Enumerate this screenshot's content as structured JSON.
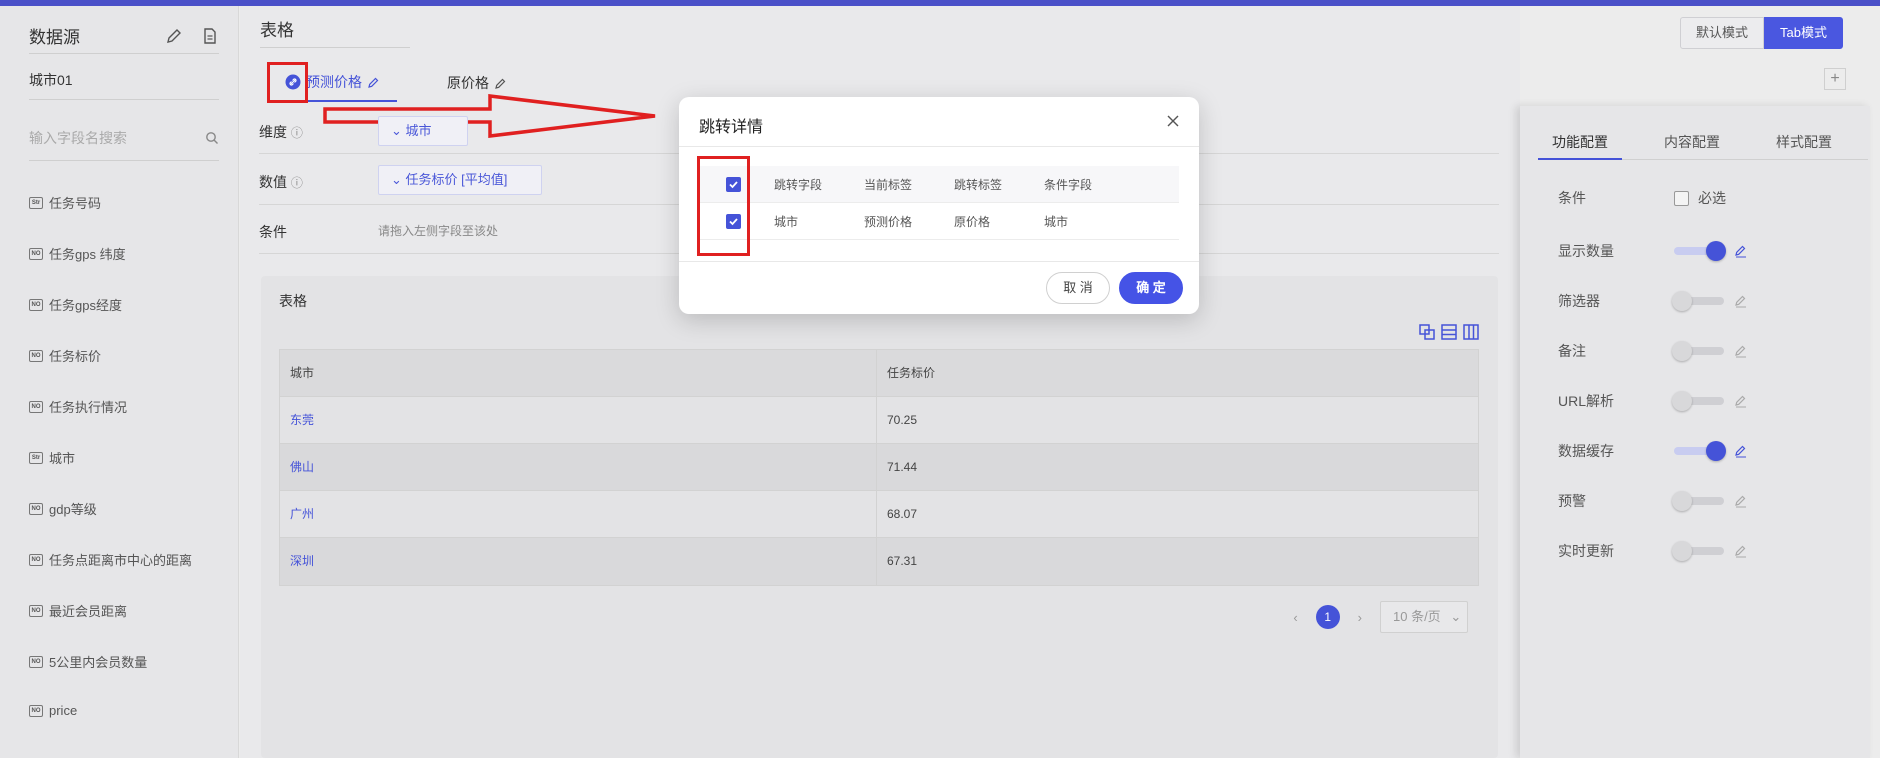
{
  "left": {
    "title": "数据源",
    "city": "城市01",
    "search_placeholder": "输入字段名搜索",
    "fields": [
      {
        "type": "Str",
        "name": "任务号码"
      },
      {
        "type": "NO",
        "name": "任务gps 纬度"
      },
      {
        "type": "NO",
        "name": "任务gps经度"
      },
      {
        "type": "NO",
        "name": "任务标价"
      },
      {
        "type": "NO",
        "name": "任务执行情况"
      },
      {
        "type": "Str",
        "name": "城市"
      },
      {
        "type": "NO",
        "name": "gdp等级"
      },
      {
        "type": "NO",
        "name": "任务点距离市中心的距离"
      },
      {
        "type": "NO",
        "name": "最近会员距离"
      },
      {
        "type": "NO",
        "name": "5公里内会员数量"
      },
      {
        "type": "NO",
        "name": "price"
      }
    ]
  },
  "main": {
    "title": "表格",
    "tabs": [
      {
        "label": "预测价格"
      },
      {
        "label": "原价格"
      }
    ],
    "dimension_label": "维度",
    "dimension_value": "城市",
    "value_label": "数值",
    "value_value": "任务标价 [平均值]",
    "condition_label": "条件",
    "condition_hint": "请拖入左侧字段至该处",
    "table": {
      "title": "表格",
      "columns": [
        "城市",
        "任务标价"
      ],
      "rows": [
        [
          "东莞",
          "70.25"
        ],
        [
          "佛山",
          "71.44"
        ],
        [
          "广州",
          "68.07"
        ],
        [
          "深圳",
          "67.31"
        ]
      ]
    },
    "pager": {
      "page": "1",
      "size": "10 条/页"
    }
  },
  "mode": {
    "default": "默认模式",
    "tab": "Tab模式"
  },
  "right": {
    "tabs": [
      "功能配置",
      "内容配置",
      "样式配置"
    ],
    "condition": {
      "label": "条件",
      "check_label": "必选"
    },
    "switches": [
      {
        "label": "显示数量",
        "on": true
      },
      {
        "label": "筛选器",
        "on": false
      },
      {
        "label": "备注",
        "on": false
      },
      {
        "label": "URL解析",
        "on": false
      },
      {
        "label": "数据缓存",
        "on": true
      },
      {
        "label": "预警",
        "on": false
      },
      {
        "label": "实时更新",
        "on": false
      }
    ]
  },
  "modal": {
    "title": "跳转详情",
    "headers": [
      "跳转字段",
      "当前标签",
      "跳转标签",
      "条件字段"
    ],
    "row": [
      "城市",
      "预测价格",
      "原价格",
      "城市"
    ],
    "cancel": "取 消",
    "ok": "确 定"
  },
  "colors": {
    "accent": "#4553d8",
    "highlight": "#e02020"
  }
}
